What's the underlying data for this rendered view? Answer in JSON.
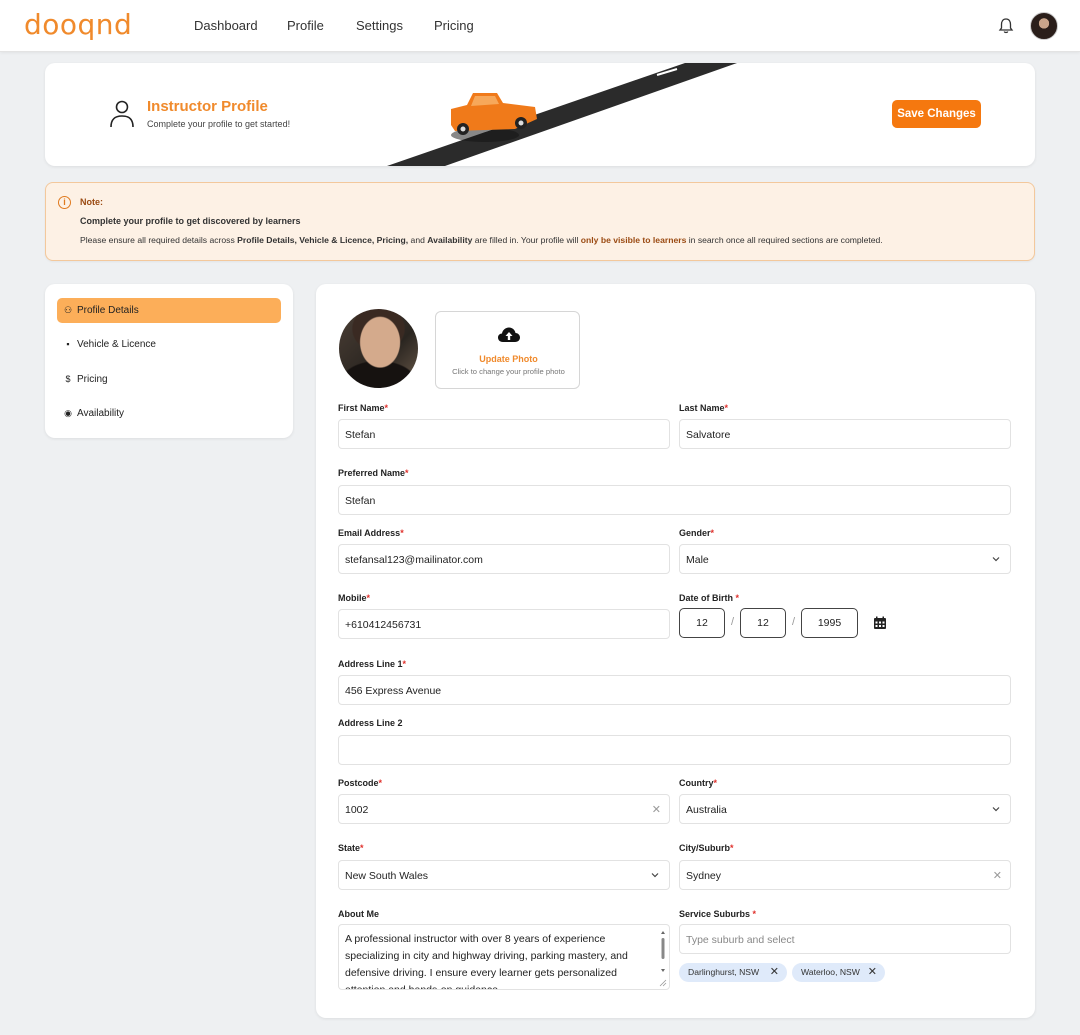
{
  "nav": {
    "logo": "dooqnd",
    "links": [
      "Dashboard",
      "Profile",
      "Settings",
      "Pricing"
    ]
  },
  "banner": {
    "title": "Instructor Profile",
    "subtitle": "Complete your profile to get started!",
    "save_label": "Save Changes"
  },
  "note": {
    "icon": "i",
    "label": "Note:",
    "heading": "Complete your profile to get discovered by learners",
    "body_1": "Please ensure all required details across ",
    "body_2": "Profile Details, Vehicle & Licence, Pricing,",
    "body_3": " and ",
    "body_4": "Availability",
    "body_5": " are filled in. Your profile will ",
    "body_6": "only be visible to learners",
    "body_7": " in search once all required sections are completed."
  },
  "sidebar": {
    "items": [
      {
        "label": "Profile Details",
        "icon": "person-icon",
        "glyph": "⚇",
        "active": true
      },
      {
        "label": "Vehicle & Licence",
        "icon": "id-card-icon",
        "glyph": "▪",
        "active": false
      },
      {
        "label": "Pricing",
        "icon": "dollar-icon",
        "glyph": "$",
        "active": false
      },
      {
        "label": "Availability",
        "icon": "availability-icon",
        "glyph": "◉",
        "active": false
      }
    ]
  },
  "photo": {
    "upload_title": "Update Photo",
    "upload_sub": "Click to change your profile photo"
  },
  "form": {
    "required_mark": "*",
    "first_name": {
      "label": "First Name",
      "value": "Stefan"
    },
    "last_name": {
      "label": "Last Name",
      "value": "Salvatore"
    },
    "preferred_name": {
      "label": "Preferred Name",
      "value": "Stefan"
    },
    "email": {
      "label": "Email Address",
      "value": "stefansal123@mailinator.com"
    },
    "gender": {
      "label": "Gender",
      "value": "Male"
    },
    "mobile": {
      "label": "Mobile",
      "value": "+610412456731"
    },
    "dob": {
      "label": "Date of Birth ",
      "day": "12",
      "month": "12",
      "year": "1995",
      "sep": "/"
    },
    "address1": {
      "label": "Address Line 1",
      "value": "456 Express Avenue"
    },
    "address2": {
      "label": "Address Line 2",
      "value": ""
    },
    "postcode": {
      "label": "Postcode",
      "value": "1002"
    },
    "country": {
      "label": "Country",
      "value": "Australia"
    },
    "state": {
      "label": "State",
      "value": "New South Wales"
    },
    "city": {
      "label": "City/Suburb",
      "value": "Sydney"
    },
    "about": {
      "label": "About Me",
      "value": "A professional instructor with over 8 years of experience specializing in city and highway driving, parking mastery, and defensive driving. I ensure every learner gets personalized attention and hands-on guidance."
    },
    "service_suburbs": {
      "label": "Service Suburbs ",
      "placeholder": "Type suburb and select",
      "tags": [
        "Darlinghurst, NSW",
        "Waterloo, NSW"
      ]
    },
    "clear_glyph": "✕"
  },
  "colors": {
    "accent": "#f08a2c",
    "save_button": "#f5780f",
    "active_nav": "#fcae59",
    "tag_bg": "#dfeafa"
  }
}
